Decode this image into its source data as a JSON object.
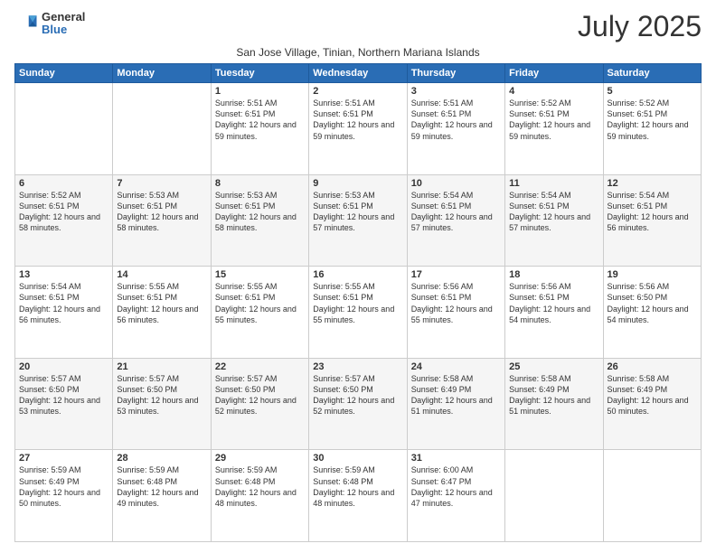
{
  "logo": {
    "general": "General",
    "blue": "Blue"
  },
  "header": {
    "month": "July 2025",
    "subtitle": "San Jose Village, Tinian, Northern Mariana Islands"
  },
  "weekdays": [
    "Sunday",
    "Monday",
    "Tuesday",
    "Wednesday",
    "Thursday",
    "Friday",
    "Saturday"
  ],
  "weeks": [
    [
      {
        "day": "",
        "info": ""
      },
      {
        "day": "",
        "info": ""
      },
      {
        "day": "1",
        "info": "Sunrise: 5:51 AM\nSunset: 6:51 PM\nDaylight: 12 hours\nand 59 minutes."
      },
      {
        "day": "2",
        "info": "Sunrise: 5:51 AM\nSunset: 6:51 PM\nDaylight: 12 hours\nand 59 minutes."
      },
      {
        "day": "3",
        "info": "Sunrise: 5:51 AM\nSunset: 6:51 PM\nDaylight: 12 hours\nand 59 minutes."
      },
      {
        "day": "4",
        "info": "Sunrise: 5:52 AM\nSunset: 6:51 PM\nDaylight: 12 hours\nand 59 minutes."
      },
      {
        "day": "5",
        "info": "Sunrise: 5:52 AM\nSunset: 6:51 PM\nDaylight: 12 hours\nand 59 minutes."
      }
    ],
    [
      {
        "day": "6",
        "info": "Sunrise: 5:52 AM\nSunset: 6:51 PM\nDaylight: 12 hours\nand 58 minutes."
      },
      {
        "day": "7",
        "info": "Sunrise: 5:53 AM\nSunset: 6:51 PM\nDaylight: 12 hours\nand 58 minutes."
      },
      {
        "day": "8",
        "info": "Sunrise: 5:53 AM\nSunset: 6:51 PM\nDaylight: 12 hours\nand 58 minutes."
      },
      {
        "day": "9",
        "info": "Sunrise: 5:53 AM\nSunset: 6:51 PM\nDaylight: 12 hours\nand 57 minutes."
      },
      {
        "day": "10",
        "info": "Sunrise: 5:54 AM\nSunset: 6:51 PM\nDaylight: 12 hours\nand 57 minutes."
      },
      {
        "day": "11",
        "info": "Sunrise: 5:54 AM\nSunset: 6:51 PM\nDaylight: 12 hours\nand 57 minutes."
      },
      {
        "day": "12",
        "info": "Sunrise: 5:54 AM\nSunset: 6:51 PM\nDaylight: 12 hours\nand 56 minutes."
      }
    ],
    [
      {
        "day": "13",
        "info": "Sunrise: 5:54 AM\nSunset: 6:51 PM\nDaylight: 12 hours\nand 56 minutes."
      },
      {
        "day": "14",
        "info": "Sunrise: 5:55 AM\nSunset: 6:51 PM\nDaylight: 12 hours\nand 56 minutes."
      },
      {
        "day": "15",
        "info": "Sunrise: 5:55 AM\nSunset: 6:51 PM\nDaylight: 12 hours\nand 55 minutes."
      },
      {
        "day": "16",
        "info": "Sunrise: 5:55 AM\nSunset: 6:51 PM\nDaylight: 12 hours\nand 55 minutes."
      },
      {
        "day": "17",
        "info": "Sunrise: 5:56 AM\nSunset: 6:51 PM\nDaylight: 12 hours\nand 55 minutes."
      },
      {
        "day": "18",
        "info": "Sunrise: 5:56 AM\nSunset: 6:51 PM\nDaylight: 12 hours\nand 54 minutes."
      },
      {
        "day": "19",
        "info": "Sunrise: 5:56 AM\nSunset: 6:50 PM\nDaylight: 12 hours\nand 54 minutes."
      }
    ],
    [
      {
        "day": "20",
        "info": "Sunrise: 5:57 AM\nSunset: 6:50 PM\nDaylight: 12 hours\nand 53 minutes."
      },
      {
        "day": "21",
        "info": "Sunrise: 5:57 AM\nSunset: 6:50 PM\nDaylight: 12 hours\nand 53 minutes."
      },
      {
        "day": "22",
        "info": "Sunrise: 5:57 AM\nSunset: 6:50 PM\nDaylight: 12 hours\nand 52 minutes."
      },
      {
        "day": "23",
        "info": "Sunrise: 5:57 AM\nSunset: 6:50 PM\nDaylight: 12 hours\nand 52 minutes."
      },
      {
        "day": "24",
        "info": "Sunrise: 5:58 AM\nSunset: 6:49 PM\nDaylight: 12 hours\nand 51 minutes."
      },
      {
        "day": "25",
        "info": "Sunrise: 5:58 AM\nSunset: 6:49 PM\nDaylight: 12 hours\nand 51 minutes."
      },
      {
        "day": "26",
        "info": "Sunrise: 5:58 AM\nSunset: 6:49 PM\nDaylight: 12 hours\nand 50 minutes."
      }
    ],
    [
      {
        "day": "27",
        "info": "Sunrise: 5:59 AM\nSunset: 6:49 PM\nDaylight: 12 hours\nand 50 minutes."
      },
      {
        "day": "28",
        "info": "Sunrise: 5:59 AM\nSunset: 6:48 PM\nDaylight: 12 hours\nand 49 minutes."
      },
      {
        "day": "29",
        "info": "Sunrise: 5:59 AM\nSunset: 6:48 PM\nDaylight: 12 hours\nand 48 minutes."
      },
      {
        "day": "30",
        "info": "Sunrise: 5:59 AM\nSunset: 6:48 PM\nDaylight: 12 hours\nand 48 minutes."
      },
      {
        "day": "31",
        "info": "Sunrise: 6:00 AM\nSunset: 6:47 PM\nDaylight: 12 hours\nand 47 minutes."
      },
      {
        "day": "",
        "info": ""
      },
      {
        "day": "",
        "info": ""
      }
    ]
  ]
}
